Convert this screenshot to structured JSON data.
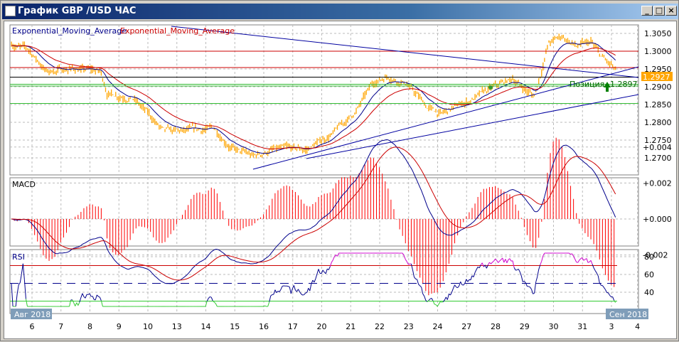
{
  "window": {
    "title": "График GBP /USD  ЧАС",
    "buttons": {
      "minimize": "_",
      "maximize": "□",
      "close": "×"
    }
  },
  "colors": {
    "price": "#ffa500",
    "ema_fast": "#00008b",
    "ema_slow": "#cc0000",
    "trend": "#0000a0",
    "macd_hist": "#ff0000",
    "rsi": "#00008b",
    "rsi_over": "#cc00cc",
    "rsi_under": "#33cc33",
    "level_green": "#33bb33"
  },
  "legend": {
    "ema1": "Exponential_Moving_Average",
    "ema2": "Exponential_Moving_Average"
  },
  "position_label": "Позиция",
  "position_price": "1.2897",
  "current_price": "1.2927",
  "macd_title": "MACD",
  "rsi_title": "RSI",
  "date_badge_left": "Авг 2018",
  "date_badge_right": "Сен 2018",
  "chart_data": [
    {
      "type": "line",
      "title": "GBP/USD H1",
      "x_labels": [
        "6",
        "7",
        "8",
        "9",
        "10",
        "13",
        "14",
        "15",
        "16",
        "17",
        "20",
        "21",
        "22",
        "23",
        "24",
        "27",
        "28",
        "29",
        "30",
        "31",
        "3",
        "4"
      ],
      "yticks": [
        "1.3050",
        "1.3000",
        "1.2950",
        "1.2900",
        "1.2850",
        "1.2800",
        "1.2750",
        "1.2700"
      ],
      "ylim": [
        1.267,
        1.3075
      ],
      "price_keypoints": [
        [
          -0.71,
          1.3022
        ],
        [
          -0.1,
          1.3002
        ],
        [
          0.52,
          1.2942
        ],
        [
          1.37,
          1.2952
        ],
        [
          2.36,
          1.2942
        ],
        [
          2.6,
          1.2882
        ],
        [
          3.46,
          1.2872
        ],
        [
          4.56,
          1.2772
        ],
        [
          5.3,
          1.2772
        ],
        [
          6.28,
          1.2782
        ],
        [
          7.02,
          1.2722
        ],
        [
          7.63,
          1.2702
        ],
        [
          8.25,
          1.2722
        ],
        [
          9.47,
          1.2722
        ],
        [
          10.45,
          1.2772
        ],
        [
          11.19,
          1.2832
        ],
        [
          11.8,
          1.2912
        ],
        [
          12.29,
          1.2932
        ],
        [
          12.9,
          1.2912
        ],
        [
          13.64,
          1.2842
        ],
        [
          14.13,
          1.2822
        ],
        [
          14.87,
          1.2852
        ],
        [
          15.85,
          1.2892
        ],
        [
          16.59,
          1.2922
        ],
        [
          17.33,
          1.2872
        ],
        [
          17.57,
          1.2942
        ],
        [
          17.82,
          1.3022
        ],
        [
          18.31,
          1.3042
        ],
        [
          18.8,
          1.3012
        ],
        [
          19.29,
          1.3022
        ],
        [
          19.66,
          1.2982
        ],
        [
          19.98,
          1.2958
        ],
        [
          20.15,
          1.2942
        ]
      ],
      "levels": [
        {
          "price": 1.3,
          "color": "red"
        },
        {
          "price": 1.2954,
          "color": "red"
        },
        {
          "price": 1.2927,
          "color": "black"
        },
        {
          "price": 1.2907,
          "color": "green"
        },
        {
          "price": 1.2902,
          "color": "green"
        },
        {
          "price": 1.2853,
          "color": "green"
        }
      ],
      "trendlines": [
        [
          [
            4.81,
            1.307
          ],
          [
            20.93,
            1.2926
          ]
        ],
        [
          [
            7.63,
            1.2668
          ],
          [
            20.93,
            1.2956
          ]
        ],
        [
          [
            9.47,
            1.2698
          ],
          [
            20.93,
            1.2878
          ]
        ]
      ]
    },
    {
      "type": "line",
      "title": "MACD",
      "yticks": [
        "+0.004",
        "+0.002",
        "+0.000",
        "-0.002"
      ],
      "ylim": [
        -0.0027,
        0.0045
      ]
    },
    {
      "type": "line",
      "title": "RSI",
      "yticks": [
        "80",
        "60",
        "40"
      ],
      "ylim": [
        22,
        87
      ],
      "levels": [
        70,
        50,
        30
      ]
    }
  ]
}
